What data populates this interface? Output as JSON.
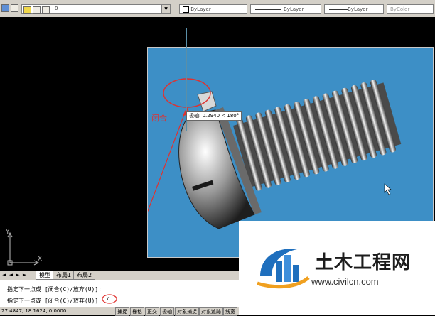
{
  "toolbar": {
    "layer_value": "0",
    "color_value": "ByLayer",
    "linetype_value": "ByLayer",
    "lineweight_value": "ByLayer",
    "plotstyle_value": "ByColor"
  },
  "drawing": {
    "tooltip": "极轴: 0.2940 < 180°",
    "annotation": "闭合",
    "ucs_x_label": "X",
    "ucs_y_label": "Y"
  },
  "tabs": {
    "nav": "◄ ◄ ► ►",
    "items": [
      {
        "label": "模型"
      },
      {
        "label": "布局1"
      },
      {
        "label": "布局2"
      }
    ]
  },
  "command": {
    "line1": "指定下一点或 [闭合(C)/放弃(U)]:",
    "line2": "指定下一点或 [闭合(C)/放弃(U)]:",
    "input": "c"
  },
  "status": {
    "coords": "27.4847, 18.1624, 0.0000",
    "buttons": [
      "捕捉",
      "栅格",
      "正交",
      "极轴",
      "对象捕捉",
      "对象追踪",
      "线宽"
    ]
  },
  "watermark": {
    "brand": "土木工程网",
    "url": "www.civilcn.com"
  },
  "colors": {
    "viewport_bg": "#3d8fc6",
    "annotation": "#e0312f",
    "ui_gray": "#d4d0c8"
  }
}
